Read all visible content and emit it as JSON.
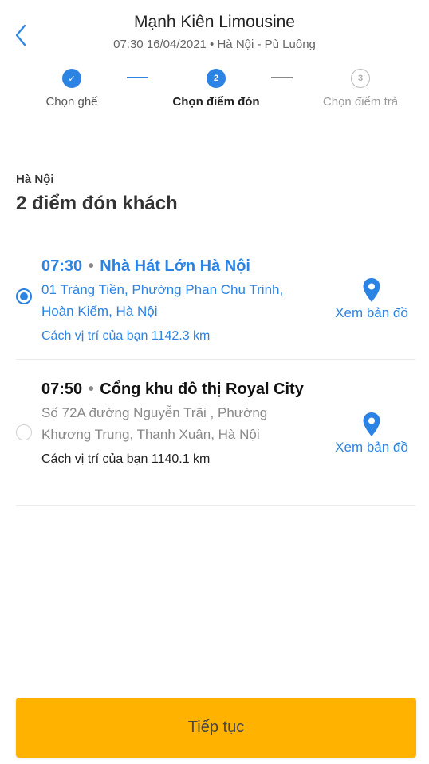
{
  "header": {
    "title": "Mạnh Kiên Limousine",
    "subtitle": "07:30 16/04/2021 • Hà Nội - Pù Luông",
    "back_icon": "chevron-left-icon"
  },
  "stepper": {
    "steps": [
      {
        "label": "Chọn ghế",
        "state": "done",
        "marker": "✓"
      },
      {
        "label": "Chọn điểm đón",
        "state": "active",
        "marker": "2"
      },
      {
        "label": "Chọn điểm trả",
        "state": "todo",
        "marker": "3"
      }
    ]
  },
  "section": {
    "city": "Hà Nội",
    "heading": "2 điểm đón khách"
  },
  "stops": [
    {
      "time": "07:30",
      "separator": "•",
      "name": "Nhà Hát Lớn Hà Nội",
      "address": "01 Tràng Tiền, Phường Phan Chu Trinh, Hoàn Kiếm, Hà Nội",
      "distance": "Cách vị trí của bạn 1142.3 km",
      "map_label": "Xem bản đồ",
      "selected": true
    },
    {
      "time": "07:50",
      "separator": "•",
      "name": "Cổng khu đô thị Royal City",
      "address": "Số 72A đường Nguyễn Trãi , Phường Khương Trung, Thanh Xuân, Hà Nội",
      "distance": "Cách vị trí của bạn 1140.1 km",
      "map_label": "Xem bản đồ",
      "selected": false
    }
  ],
  "footer": {
    "continue_label": "Tiếp tục"
  },
  "colors": {
    "accent": "#2b83e3",
    "button": "#ffb300"
  }
}
